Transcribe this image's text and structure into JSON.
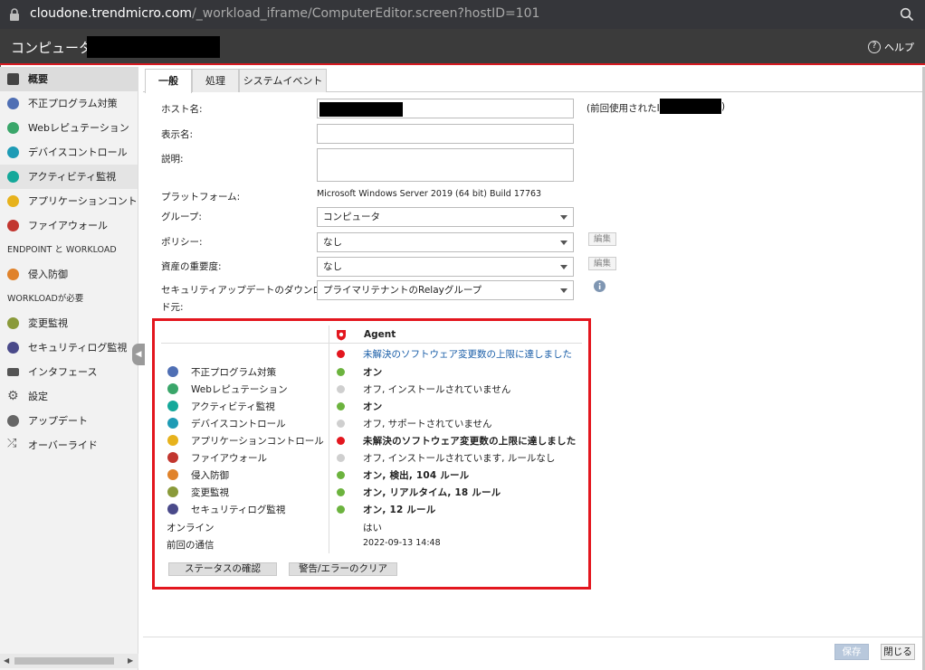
{
  "browser": {
    "url_host": "cloudone.trendmicro.com",
    "url_path": "/_workload_iframe/ComputerEditor.screen?hostID=101"
  },
  "header": {
    "title": "コンピュータ:",
    "help_label": "ヘルプ"
  },
  "sidebar": {
    "items": [
      {
        "label": "概要",
        "icon": "overview-icon",
        "color": "#444444"
      },
      {
        "label": "不正プログラム対策",
        "icon": "anti-malware-icon",
        "color": "#4f6fb4"
      },
      {
        "label": "Webレピュテーション",
        "icon": "web-reputation-icon",
        "color": "#3aa66a"
      },
      {
        "label": "デバイスコントロール",
        "icon": "device-control-icon",
        "color": "#1e9bb5"
      },
      {
        "label": "アクティビティ監視",
        "icon": "activity-monitoring-icon",
        "color": "#14a89a"
      },
      {
        "label": "アプリケーションコントロール",
        "icon": "application-control-icon",
        "color": "#e7b21c"
      },
      {
        "label": "ファイアウォール",
        "icon": "firewall-icon",
        "color": "#c2362f"
      }
    ],
    "section_endpoint": "ENDPOINT と WORKLOAD",
    "items2": [
      {
        "label": "侵入防御",
        "icon": "intrusion-prevention-icon",
        "color": "#e0822a"
      }
    ],
    "section_workload": "WORKLOADが必要",
    "items3": [
      {
        "label": "変更監視",
        "icon": "integrity-monitoring-icon",
        "color": "#8a9a3a"
      },
      {
        "label": "セキュリティログ監視",
        "icon": "log-inspection-icon",
        "color": "#4a4a8a"
      },
      {
        "label": "インタフェース",
        "icon": "interface-icon",
        "color": "#555555"
      },
      {
        "label": "設定",
        "icon": "settings-icon",
        "color": "#555555"
      },
      {
        "label": "アップデート",
        "icon": "update-icon",
        "color": "#555555"
      },
      {
        "label": "オーバーライド",
        "icon": "override-icon",
        "color": "#555555"
      }
    ]
  },
  "tabs": [
    "一般",
    "処理",
    "システムイベント"
  ],
  "form": {
    "hostname_label": "ホスト名:",
    "last_ip_label": "(前回使用されたIP:",
    "last_ip_suffix": ")",
    "display_name_label": "表示名:",
    "description_label": "説明:",
    "platform_label": "プラットフォーム:",
    "platform_value": "Microsoft Windows Server 2019 (64 bit) Build 17763",
    "group_label": "グループ:",
    "group_value": "コンピュータ",
    "policy_label": "ポリシー:",
    "policy_value": "なし",
    "asset_label": "資産の重要度:",
    "asset_value": "なし",
    "edit_label": "編集",
    "download_label_1": "セキュリティアップデートのダウンロー",
    "download_label_2": "ド元:",
    "download_value": "プライマリテナントのRelayグループ"
  },
  "status": {
    "agent_header": "Agent",
    "summary": "未解決のソフトウェア変更数の上限に達しました",
    "rows": [
      {
        "name": "不正プログラム対策",
        "value": "オン",
        "dot": "#6cb33e",
        "bold": true,
        "icon_color": "#4f6fb4"
      },
      {
        "name": "Webレピュテーション",
        "value": "オフ, インストールされていません",
        "dot": "#cfcfcf",
        "bold": false,
        "icon_color": "#3aa66a"
      },
      {
        "name": "アクティビティ監視",
        "value": "オン",
        "dot": "#6cb33e",
        "bold": true,
        "icon_color": "#14a89a"
      },
      {
        "name": "デバイスコントロール",
        "value": "オフ, サポートされていません",
        "dot": "#cfcfcf",
        "bold": false,
        "icon_color": "#1e9bb5"
      },
      {
        "name": "アプリケーションコントロール",
        "value": "未解決のソフトウェア変更数の上限に達しました",
        "dot": "#e3161e",
        "bold": true,
        "icon_color": "#e7b21c"
      },
      {
        "name": "ファイアウォール",
        "value": "オフ, インストールされています, ルールなし",
        "dot": "#cfcfcf",
        "bold": false,
        "icon_color": "#c2362f"
      },
      {
        "name": "侵入防御",
        "value": "オン, 検出, 104 ルール",
        "dot": "#6cb33e",
        "bold": true,
        "icon_color": "#e0822a"
      },
      {
        "name": "変更監視",
        "value": "オン, リアルタイム, 18 ルール",
        "dot": "#6cb33e",
        "bold": true,
        "icon_color": "#8a9a3a"
      },
      {
        "name": "セキュリティログ監視",
        "value": "オン, 12 ルール",
        "dot": "#6cb33e",
        "bold": true,
        "icon_color": "#4a4a8a"
      }
    ],
    "online_label": "オンライン",
    "online_value": "はい",
    "last_comm_label": "前回の通信",
    "last_comm_value": "2022-09-13 14:48",
    "check_status_button": "ステータスの確認",
    "clear_warnings_button": "警告/エラーのクリア"
  },
  "footer": {
    "save_label": "保存",
    "close_label": "閉じる"
  }
}
